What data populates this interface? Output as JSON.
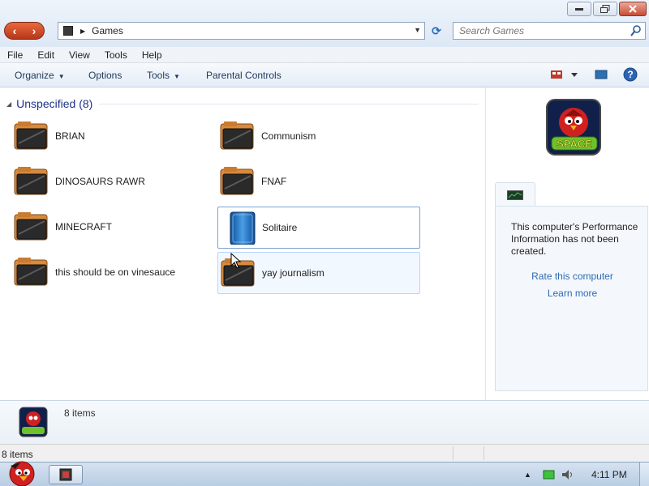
{
  "window": {
    "address_path": "Games",
    "search_placeholder": "Search Games",
    "controls": {
      "minimize": "minimize",
      "maximize": "maximize",
      "close": "close"
    }
  },
  "menu": [
    "File",
    "Edit",
    "View",
    "Tools",
    "Help"
  ],
  "commands": {
    "organize": "Organize",
    "options": "Options",
    "tools": "Tools",
    "parental_controls": "Parental Controls"
  },
  "group": {
    "title": "Unspecified (8)",
    "items": [
      {
        "label": "BRIAN",
        "icon": "game-folder-icon"
      },
      {
        "label": "Communism",
        "icon": "game-folder-icon"
      },
      {
        "label": "DINOSAURS RAWR",
        "icon": "game-folder-icon"
      },
      {
        "label": "FNAF",
        "icon": "game-folder-icon"
      },
      {
        "label": "MINECRAFT",
        "icon": "game-folder-icon"
      },
      {
        "label": "Solitaire",
        "icon": "solitaire-icon",
        "state": "selected"
      },
      {
        "label": "this should be on vinesauce",
        "icon": "game-folder-icon"
      },
      {
        "label": "yay journalism",
        "icon": "game-folder-icon",
        "state": "hover"
      }
    ]
  },
  "details_pane": {
    "game_icon": "angry-birds-space-icon",
    "badge_text": "SPACE",
    "perf_text": "This computer's Performance Information has not been created.",
    "rate_link": "Rate this computer",
    "learn_link": "Learn more"
  },
  "details_bar": {
    "count": "8 items"
  },
  "status_bar": {
    "text": "8 items"
  },
  "taskbar": {
    "clock": "4:11 PM"
  },
  "colors": {
    "accent_link": "#2c6ab3",
    "group_title": "#1e3287",
    "nav_button": "#d0502c"
  }
}
